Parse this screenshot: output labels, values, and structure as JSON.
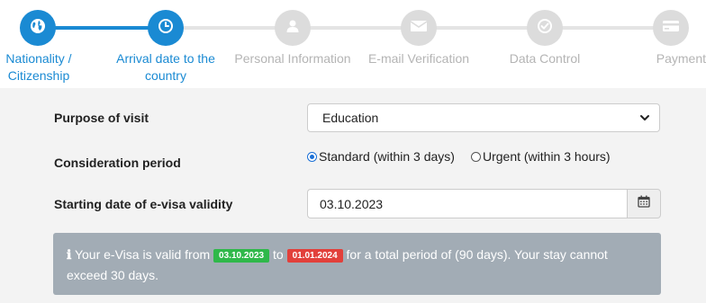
{
  "colors": {
    "accent": "#1a8ad3",
    "inactive_step": "#dcdcdc",
    "info_bg": "#a2acb5",
    "badge_from": "#2fb84a",
    "badge_to": "#e2403b"
  },
  "stepper": {
    "steps": [
      {
        "label": "Nationality /\nCitizenship",
        "icon": "globe-icon",
        "state": "completed"
      },
      {
        "label": "Arrival date to the\ncountry",
        "icon": "clock-icon",
        "state": "current"
      },
      {
        "label": "Personal Information",
        "icon": "user-icon",
        "state": "pending"
      },
      {
        "label": "E-mail Verification",
        "icon": "envelope-icon",
        "state": "pending"
      },
      {
        "label": "Data Control",
        "icon": "check-circle-icon",
        "state": "pending"
      },
      {
        "label": "Payment",
        "icon": "credit-card-icon",
        "state": "pending"
      }
    ]
  },
  "form": {
    "purpose": {
      "label": "Purpose of visit",
      "value": "Education"
    },
    "consideration": {
      "label": "Consideration period",
      "options": [
        {
          "label": "Standard (within 3 days)",
          "checked": true
        },
        {
          "label": "Urgent (within 3 hours)",
          "checked": false
        }
      ]
    },
    "start_date": {
      "label": "Starting date of e-visa validity",
      "value": "03.10.2023"
    }
  },
  "info": {
    "icon": "info-icon",
    "prefix": "Your e-Visa is valid from",
    "from_date": "03.10.2023",
    "to_word": "to",
    "to_date": "01.01.2024",
    "suffix": "for a total period of (90 days). Your stay cannot exceed 30 days."
  }
}
